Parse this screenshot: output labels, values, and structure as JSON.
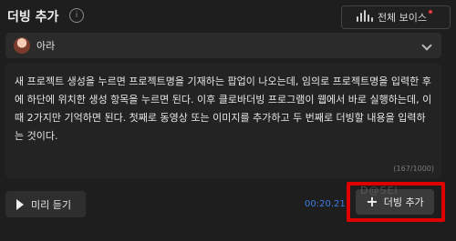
{
  "header": {
    "title": "더빙 추가",
    "info_icon_glyph": "i",
    "all_voices_label": "전체 보이스"
  },
  "voice": {
    "name": "아라"
  },
  "script": {
    "text": "새 프로젝트 생성을 누르면 프로젝트명을 기재하는 팝업이 나오는데, 임의로 프로젝트명을 입력한 후에 하단에 위치한 생성 항목을 누르면 된다. 이후 클로바더빙 프로그램이 웹에서 바로 실행하는데, 이때 2가지만 기억하면 된다. 첫째로 동영상 또는 이미지를 추가하고 두 번째로 더빙할 내용을 입력하는 것이다.",
    "char_count": "(167/1000)"
  },
  "footer": {
    "preview_label": "미리 듣기",
    "duration": "00:20.21",
    "add_label": "더빙 추가",
    "plus_glyph": "+",
    "watermark": "D@SEI"
  },
  "colors": {
    "accent_blue": "#3b7de3",
    "highlight_red": "#e00000",
    "notification_dot": "#e23b3b"
  },
  "icons": [
    "info-icon",
    "voice-wave-icon",
    "chevron-down-icon",
    "play-icon",
    "plus-icon"
  ]
}
